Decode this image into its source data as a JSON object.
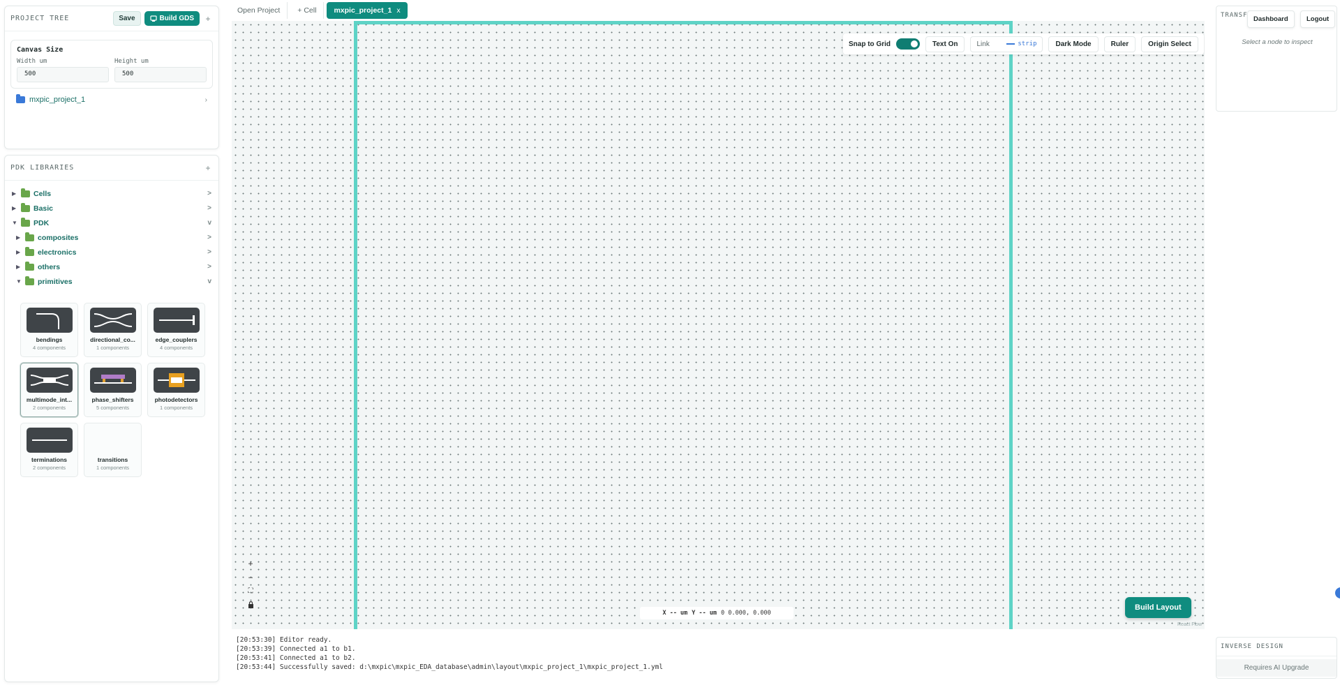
{
  "project_tree": {
    "title": "PROJECT TREE",
    "save_label": "Save",
    "build_gds_label": "Build GDS",
    "plus": "+",
    "canvas_size": {
      "title": "Canvas Size",
      "width_label": "Width um",
      "height_label": "Height um",
      "width_value": "500",
      "height_value": "500"
    },
    "project_name": "mxpic_project_1"
  },
  "pdk": {
    "title": "PDK LIBRARIES",
    "plus": "+",
    "tree": [
      {
        "label": "Cells",
        "chev": ">"
      },
      {
        "label": "Basic",
        "chev": ">"
      },
      {
        "label": "PDK",
        "chev": "v"
      },
      {
        "label": "composites",
        "chev": ">"
      },
      {
        "label": "electronics",
        "chev": ">"
      },
      {
        "label": "others",
        "chev": ">"
      },
      {
        "label": "primitives",
        "chev": "v"
      }
    ],
    "cards": [
      {
        "name": "bendings",
        "count": "4 components"
      },
      {
        "name": "directional_co...",
        "count": "1 components"
      },
      {
        "name": "edge_couplers",
        "count": "4 components"
      },
      {
        "name": "multimode_int...",
        "count": "2 components"
      },
      {
        "name": "phase_shifters",
        "count": "5 components"
      },
      {
        "name": "photodetectors",
        "count": "1 components"
      },
      {
        "name": "terminations",
        "count": "2 components"
      },
      {
        "name": "transitions",
        "count": "1 components"
      }
    ]
  },
  "tabs": {
    "open_project": "Open Project",
    "add_cell": "+ Cell",
    "active": "mxpic_project_1",
    "close": "x"
  },
  "toolbar": {
    "snap_label": "Snap to Grid",
    "text_on": "Text On",
    "link_label": "Link",
    "link_value": "strip",
    "dark_mode": "Dark Mode",
    "ruler": "Ruler",
    "origin_select": "Origin Select"
  },
  "zoom": {
    "in": "+",
    "out": "−",
    "fit": "⛶",
    "lock": "🔒"
  },
  "coords": {
    "x": "X -- um",
    "y": "Y -- um",
    "values": "0 0.000, 0.000"
  },
  "build_layout": "Build Layout",
  "react_flow": "React Flow",
  "log": [
    "[20:53:30] Editor ready.",
    "[20:53:39] Connected a1 to b1.",
    "[20:53:41] Connected a1 to b2.",
    "[20:53:44] Successfully saved: d:\\mxpic\\mxpic_EDA_database\\admin\\layout\\mxpic_project_1\\mxpic_project_1.yml"
  ],
  "right": {
    "title": "TRANSF",
    "dashboard": "Dashboard",
    "logout": "Logout",
    "inspect_hint": "Select a node to inspect",
    "inverse_title": "INVERSE DESIGN",
    "upgrade": "Requires AI Upgrade"
  },
  "colors": {
    "accent": "#0f8c7f",
    "canvas_border": "#5ed3c6",
    "folder_blue": "#3a79d8",
    "folder_green": "#69a64a"
  }
}
